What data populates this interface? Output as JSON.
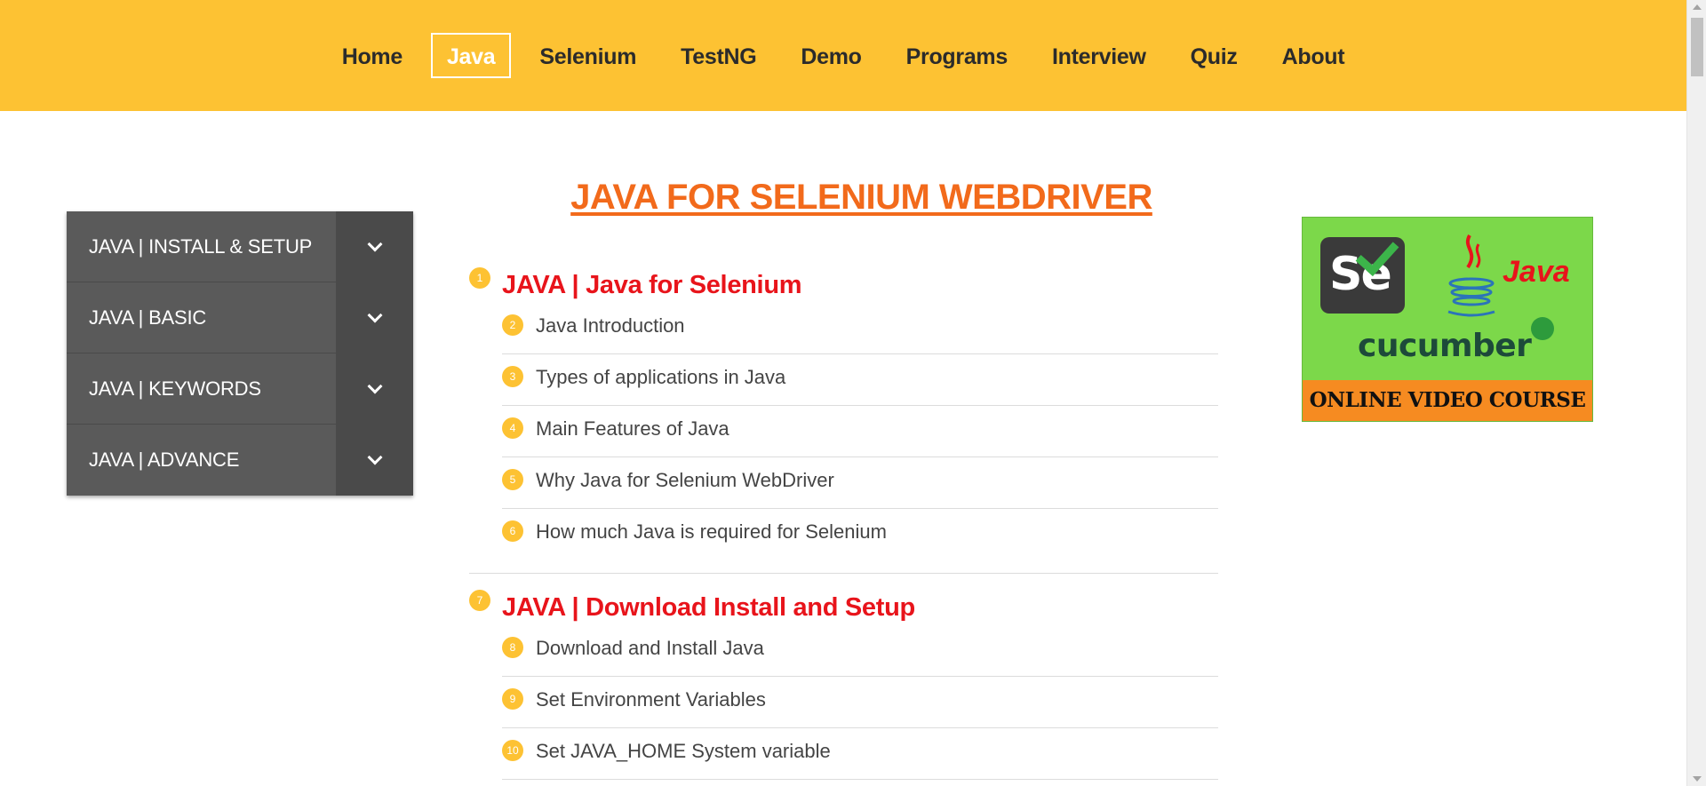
{
  "nav": {
    "items": [
      {
        "label": "Home",
        "active": false
      },
      {
        "label": "Java",
        "active": true
      },
      {
        "label": "Selenium",
        "active": false
      },
      {
        "label": "TestNG",
        "active": false
      },
      {
        "label": "Demo",
        "active": false
      },
      {
        "label": "Programs",
        "active": false
      },
      {
        "label": "Interview",
        "active": false
      },
      {
        "label": "Quiz",
        "active": false
      },
      {
        "label": "About",
        "active": false
      }
    ]
  },
  "sidebar": {
    "items": [
      {
        "label": "JAVA | INSTALL & SETUP",
        "icon": "chevron-down-icon"
      },
      {
        "label": "JAVA | BASIC",
        "icon": "chevron-down-icon"
      },
      {
        "label": "JAVA | KEYWORDS",
        "icon": "chevron-down-icon"
      },
      {
        "label": "JAVA | ADVANCE",
        "icon": "chevron-down-icon"
      }
    ]
  },
  "main": {
    "title": "JAVA FOR SELENIUM WEBDRIVER",
    "sections": [
      {
        "num": "1",
        "title": "JAVA | Java for Selenium",
        "items": [
          {
            "num": "2",
            "label": "Java Introduction"
          },
          {
            "num": "3",
            "label": "Types of applications in Java"
          },
          {
            "num": "4",
            "label": "Main Features of Java"
          },
          {
            "num": "5",
            "label": "Why Java for Selenium WebDriver"
          },
          {
            "num": "6",
            "label": "How much Java is required for Selenium"
          }
        ]
      },
      {
        "num": "7",
        "title": "JAVA | Download Install and Setup",
        "items": [
          {
            "num": "8",
            "label": "Download and Install Java"
          },
          {
            "num": "9",
            "label": "Set Environment Variables"
          },
          {
            "num": "10",
            "label": "Set JAVA_HOME System variable"
          }
        ]
      }
    ]
  },
  "ad": {
    "se_text": "Se",
    "java_text": "Java",
    "cucumber_text": "cucumber",
    "banner_text": "ONLINE VIDEO COURSE"
  },
  "colors": {
    "nav_bg": "#fdc233",
    "title": "#f26a1b",
    "section_title": "#e8141b",
    "sidebar_label_bg": "#5a5a5a",
    "sidebar_toggle_bg": "#4a4a4a",
    "ad_bg": "#7cd84a",
    "ad_banner": "#f68b21"
  }
}
